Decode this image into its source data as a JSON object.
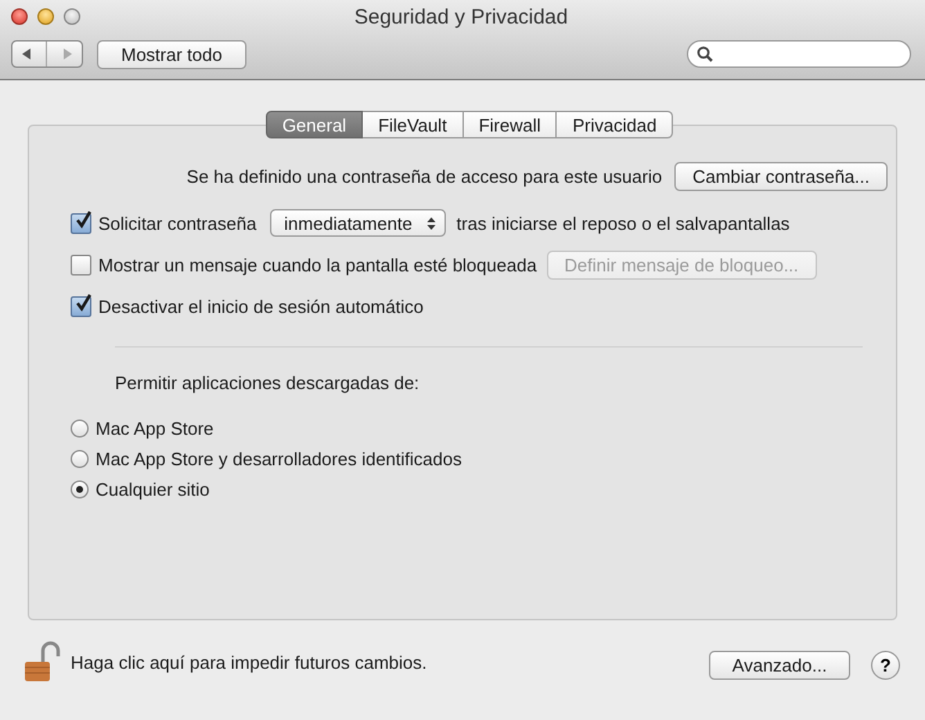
{
  "window": {
    "title": "Seguridad y Privacidad"
  },
  "toolbar": {
    "show_all_button": "Mostrar todo"
  },
  "tabs": [
    {
      "label": "General",
      "selected": true
    },
    {
      "label": "FileVault",
      "selected": false
    },
    {
      "label": "Firewall",
      "selected": false
    },
    {
      "label": "Privacidad",
      "selected": false
    }
  ],
  "password_row": {
    "label": "Se ha definido una contraseña de acceso para este usuario",
    "button": "Cambiar contraseña..."
  },
  "options": [
    {
      "kind": "checkbox-select",
      "label": "Solicitar contraseña",
      "checked": true,
      "select_value": "inmediatamente",
      "suffix": "tras iniciarse el reposo o el salvapantallas"
    },
    {
      "kind": "checkbox-button",
      "label": "Mostrar un mensaje cuando la pantalla esté bloqueada",
      "checked": false,
      "button": "Definir mensaje de bloqueo...",
      "button_disabled": true
    },
    {
      "kind": "checkbox",
      "label": "Desactivar el inicio de sesión automático",
      "checked": true
    }
  ],
  "downloads": {
    "label": "Permitir aplicaciones descargadas de:",
    "options": [
      {
        "label": "Mac App Store",
        "selected": false
      },
      {
        "label": "Mac App Store y desarrolladores identificados",
        "selected": false
      },
      {
        "label": "Cualquier sitio",
        "selected": true
      }
    ]
  },
  "footer": {
    "locked": false,
    "lock_text": "Haga clic aquí para impedir futuros cambios.",
    "advanced_button": "Avanzado...",
    "help_button": "?"
  }
}
